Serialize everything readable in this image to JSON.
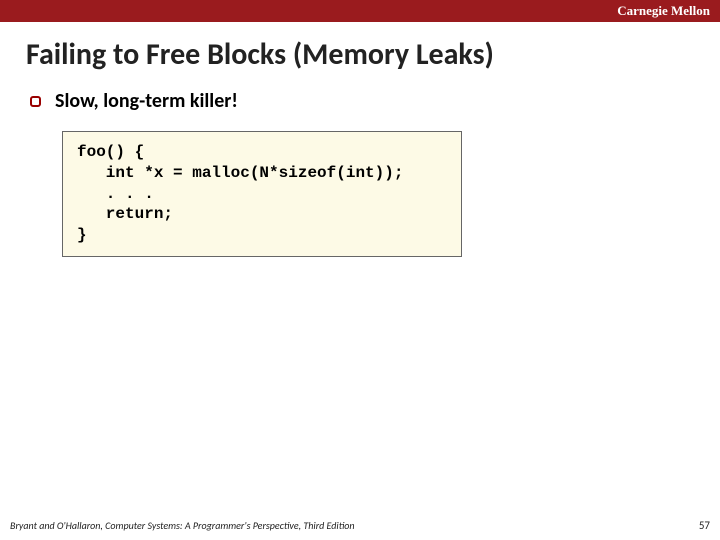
{
  "header": {
    "brand": "Carnegie Mellon"
  },
  "title": "Failing to Free Blocks (Memory Leaks)",
  "bullets": [
    {
      "text": "Slow, long-term killer!"
    }
  ],
  "code": "foo() {\n   int *x = malloc(N*sizeof(int));\n   . . .\n   return;\n}",
  "footer": {
    "left": "Bryant and O'Hallaron, Computer Systems: A Programmer's Perspective, Third Edition",
    "page": "57"
  }
}
